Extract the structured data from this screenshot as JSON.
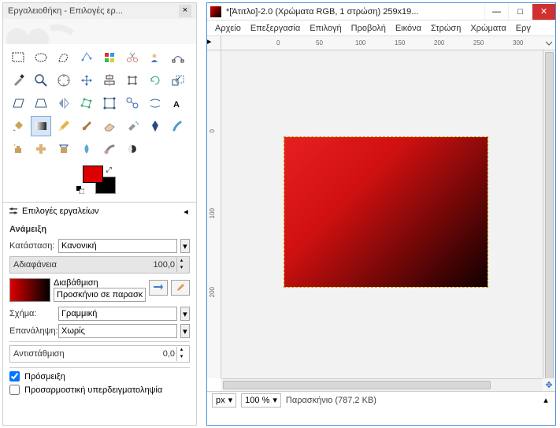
{
  "toolbox": {
    "title": "Εργαλειοθήκη - Επιλογές ερ...",
    "colors": {
      "fg": "#d00000",
      "bg": "#000000"
    },
    "options": {
      "header": "Επιλογές εργαλείων",
      "tool_name": "Ανάμειξη",
      "mode_label": "Κατάσταση:",
      "mode_value": "Κανονική",
      "opacity_label": "Αδιαφάνεια",
      "opacity_value": "100,0",
      "gradient_label": "Διαβάθμιση",
      "gradient_source": "Προσκήνιο σε παρασκ",
      "shape_label": "Σχήμα:",
      "shape_value": "Γραμμική",
      "repeat_label": "Επανάληψη:",
      "repeat_value": "Χωρίς",
      "offset_label": "Αντιστάθμιση",
      "offset_value": "0,0",
      "dither_label": "Πρόσμειξη",
      "supersample_label": "Προσαρμοστική υπερδειγματοληψία"
    }
  },
  "canvas_window": {
    "title": "*[Άτιτλο]-2.0 (Χρώματα RGB, 1 στρώση) 259x19...",
    "menu": [
      "Αρχείο",
      "Επεξεργασία",
      "Επιλογή",
      "Προβολή",
      "Εικόνα",
      "Στρώση",
      "Χρώματα",
      "Εργ"
    ],
    "ruler_h": [
      "0",
      "50",
      "100",
      "150",
      "200",
      "250",
      "300"
    ],
    "ruler_v": [
      "0",
      "100",
      "200"
    ],
    "status": {
      "unit": "px",
      "zoom": "100 %",
      "info": "Παρασκήνιο (787,2 KB)"
    }
  }
}
